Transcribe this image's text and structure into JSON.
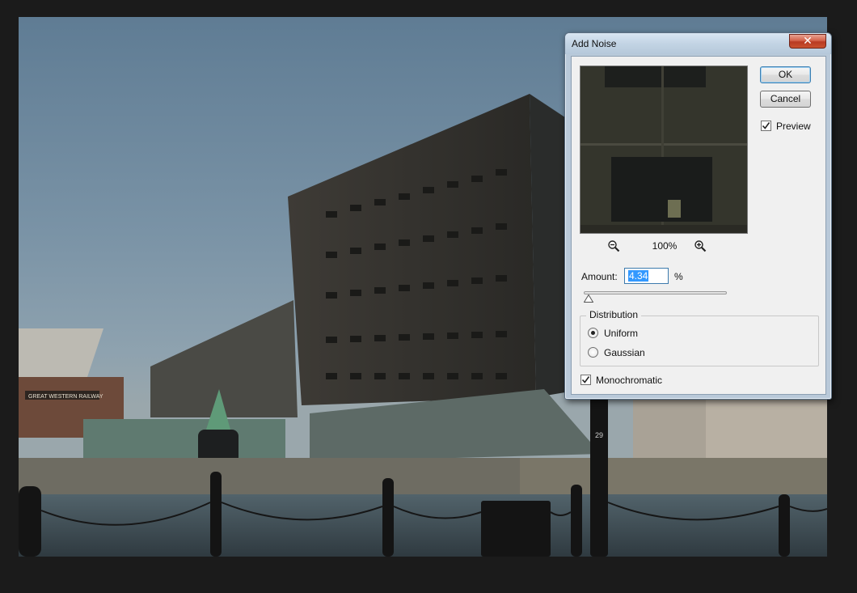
{
  "dialog": {
    "title": "Add Noise",
    "close_icon": "close-icon",
    "ok_label": "OK",
    "cancel_label": "Cancel",
    "preview": {
      "label": "Preview",
      "checked": true
    },
    "zoom": {
      "out_icon": "zoom-out-icon",
      "level": "100%",
      "in_icon": "zoom-in-icon"
    },
    "amount": {
      "label": "Amount:",
      "value": "4.34",
      "unit": "%",
      "slider_fraction": 0.0109
    },
    "distribution": {
      "legend": "Distribution",
      "options": [
        {
          "label": "Uniform",
          "checked": true
        },
        {
          "label": "Gaussian",
          "checked": false
        }
      ]
    },
    "monochromatic": {
      "label": "Monochromatic",
      "checked": true
    }
  },
  "canvas": {
    "building_sign": "GREAT WESTERN RAILWAY",
    "marker_text": "29"
  },
  "colors": {
    "titlebar": "#c3d4e4",
    "close_button": "#c9512f",
    "selection": "#3399ff",
    "app_background": "#1b1b1b"
  }
}
